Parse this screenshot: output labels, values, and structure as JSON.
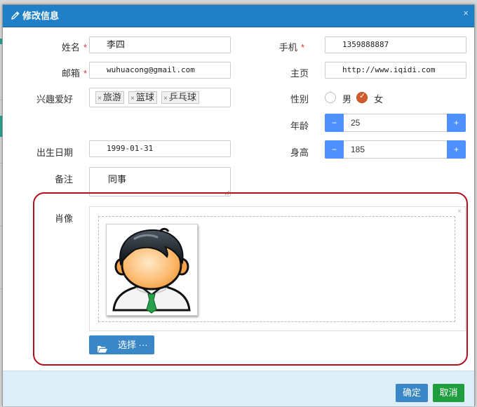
{
  "dialog": {
    "title": "修改信息",
    "close_icon": "close-icon"
  },
  "form": {
    "name": {
      "label": "姓名",
      "required_mark": "*",
      "value": "李四"
    },
    "email": {
      "label": "邮箱",
      "required_mark": "*",
      "value": "wuhuacong@gmail.com"
    },
    "hobbies": {
      "label": "兴趣爱好",
      "tags": [
        "旅游",
        "篮球",
        "乒乓球"
      ]
    },
    "birthday": {
      "label": "出生日期",
      "value": "1999-01-31"
    },
    "note": {
      "label": "备注",
      "value": "同事"
    },
    "phone": {
      "label": "手机",
      "required_mark": "*",
      "value": "1359888887"
    },
    "homepage": {
      "label": "主页",
      "value": "http://www.iqidi.com"
    },
    "gender": {
      "label": "性别",
      "options": [
        "男",
        "女"
      ],
      "selected": "女"
    },
    "age": {
      "label": "年龄",
      "value": "25",
      "minus": "−",
      "plus": "+"
    },
    "height": {
      "label": "身高",
      "value": "185",
      "minus": "−",
      "plus": "+"
    },
    "photo": {
      "label": "肖像",
      "select_button": "选择 ···",
      "remove_icon": "×"
    }
  },
  "footer": {
    "ok": "确定",
    "cancel": "取消"
  },
  "colors": {
    "header": "#1f7fc7",
    "primary": "#3a87c8",
    "success": "#1e9e3e",
    "spinner": "#4d90fe",
    "highlight": "#b30f1e",
    "required": "#d33"
  }
}
